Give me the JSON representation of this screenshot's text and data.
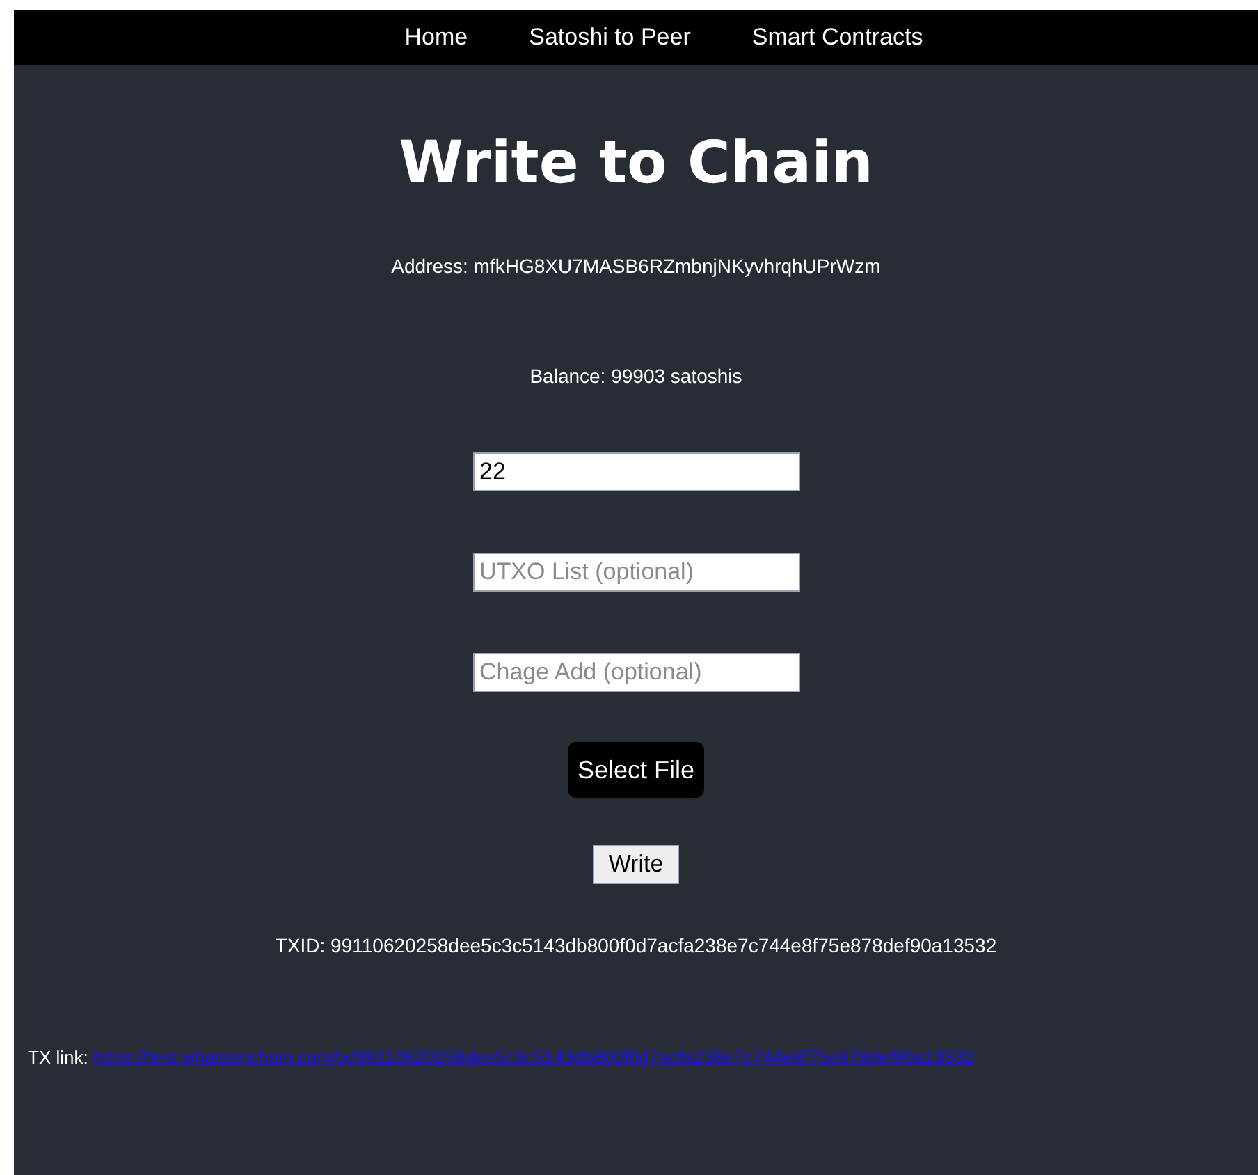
{
  "nav": [
    {
      "label": "Home"
    },
    {
      "label": "Satoshi to Peer"
    },
    {
      "label": "Smart Contracts"
    }
  ],
  "title": "Write to Chain",
  "address": "Address: mfkHG8XU7MASB6RZmbnjNKyvhrqhUPrWzm",
  "balance": "Balance: 99903 satoshis",
  "fields": [
    {
      "value": "22"
    },
    {
      "placeholder": "UTXO List (optional)"
    },
    {
      "placeholder": "Chage Add (optional)"
    }
  ],
  "select_file_button": "Select File",
  "write_button": "Write",
  "txid": "TXID: 99110620258dee5c3c5143db800f0d7acfa238e7c744e8f75e878def90a13532",
  "tx_link": {
    "label": "TX link:",
    "url": "https://test.whatsonchain.com/tx/99110620258dee5c3c5143db800f0d7acfa238e7c744e8f75e878def90a13532"
  }
}
